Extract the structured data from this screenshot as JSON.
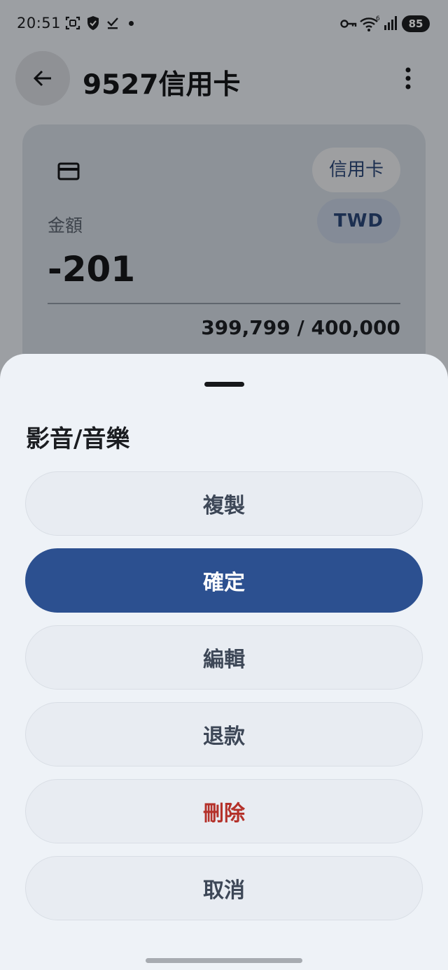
{
  "status_bar": {
    "time": "20:51",
    "battery": "85",
    "icons": [
      "screenshot-icon",
      "shield-icon",
      "download-done-icon",
      "dot-icon",
      "vpn-key-icon",
      "wifi-icon",
      "signal-icon"
    ]
  },
  "header": {
    "title": "9527信用卡",
    "back_icon": "arrow-left-icon",
    "menu_icon": "more-vert-icon"
  },
  "card": {
    "icon": "credit-card-icon",
    "type_chip": "信用卡",
    "currency_chip": "TWD",
    "amount_label": "金額",
    "amount": "-201",
    "limit": "399,799 / 400,000"
  },
  "sheet": {
    "title": "影音/音樂",
    "actions": [
      {
        "label": "複製",
        "style": "default"
      },
      {
        "label": "確定",
        "style": "primary"
      },
      {
        "label": "編輯",
        "style": "default"
      },
      {
        "label": "退款",
        "style": "default"
      },
      {
        "label": "刪除",
        "style": "danger"
      },
      {
        "label": "取消",
        "style": "default"
      }
    ]
  },
  "colors": {
    "primary": "#2c5090",
    "danger": "#b4312a",
    "sheet_bg": "#eef2f7"
  }
}
